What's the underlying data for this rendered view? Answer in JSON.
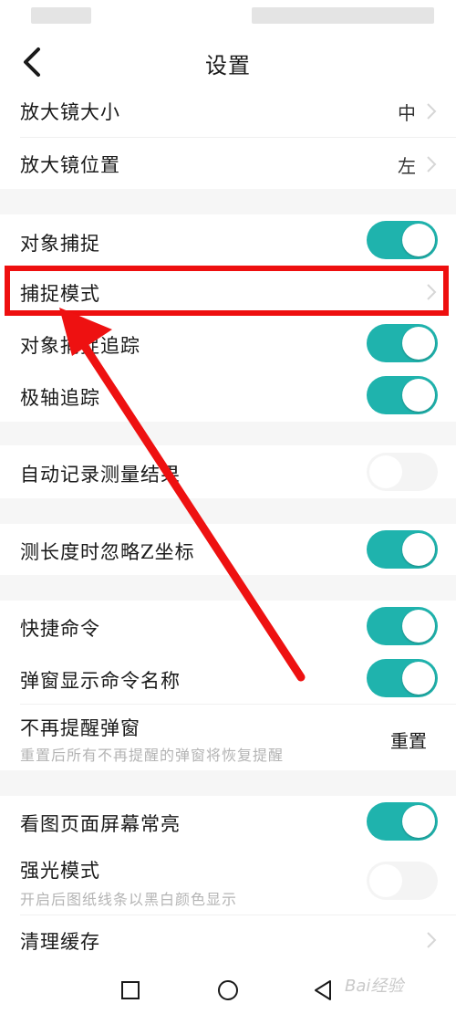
{
  "header": {
    "title": "设置"
  },
  "settings": {
    "magnifier_size": {
      "label": "放大镜大小",
      "value": "中"
    },
    "magnifier_position": {
      "label": "放大镜位置",
      "value": "左"
    },
    "object_snap": {
      "label": "对象捕捉",
      "toggle": "on"
    },
    "snap_mode": {
      "label": "捕捉模式"
    },
    "object_snap_tracking": {
      "label": "对象捕捉追踪",
      "toggle": "on"
    },
    "polar_tracking": {
      "label": "极轴追踪",
      "toggle": "on"
    },
    "auto_record_measure": {
      "label": "自动记录测量结果",
      "toggle": "off"
    },
    "ignore_z": {
      "label": "测长度时忽略Z坐标",
      "toggle": "on"
    },
    "shortcut_command": {
      "label": "快捷命令",
      "toggle": "on"
    },
    "popup_command_name": {
      "label": "弹窗显示命令名称",
      "toggle": "on"
    },
    "no_reminder_popup": {
      "label": "不再提醒弹窗",
      "sublabel": "重置后所有不再提醒的弹窗将恢复提醒",
      "action": "重置"
    },
    "screen_always_on": {
      "label": "看图页面屏幕常亮",
      "toggle": "on"
    },
    "strong_light_mode": {
      "label": "强光模式",
      "sublabel": "开启后图纸线条以黑白颜色显示",
      "toggle": "off"
    },
    "clear_cache": {
      "label": "清理缓存"
    }
  },
  "colors": {
    "toggle_on": "#1fb3ad",
    "highlight": "#ee0f0f"
  },
  "watermark": "Bai经验"
}
